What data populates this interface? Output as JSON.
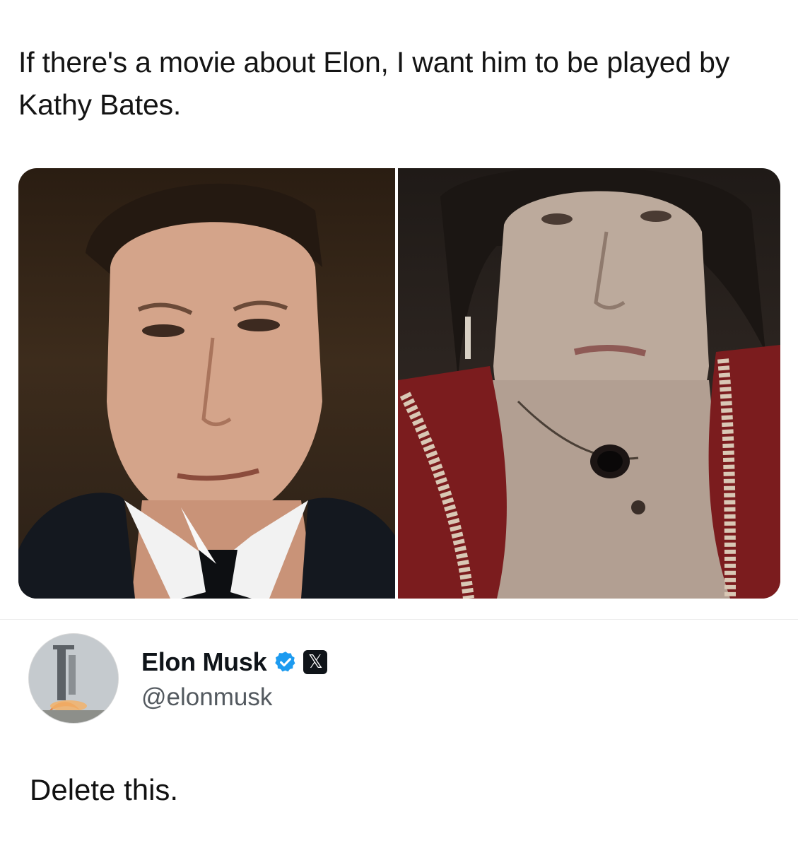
{
  "post": {
    "text": "If there's a movie about Elon, I want him to be played by Kathy Bates."
  },
  "media": {
    "left_photo": {
      "icon": "elon-musk-portrait"
    },
    "right_photo": {
      "icon": "kathy-bates-portrait"
    }
  },
  "reply": {
    "author": {
      "name": "Elon Musk",
      "handle": "@elonmusk",
      "verified": true,
      "platform_icon": "x-logo-icon",
      "avatar_icon": "rocket-launch-avatar"
    },
    "text": "Delete this."
  },
  "colors": {
    "verified_blue": "#1d9bf0",
    "text": "#141414",
    "secondary_text": "#53595f",
    "background": "#ffffff"
  }
}
